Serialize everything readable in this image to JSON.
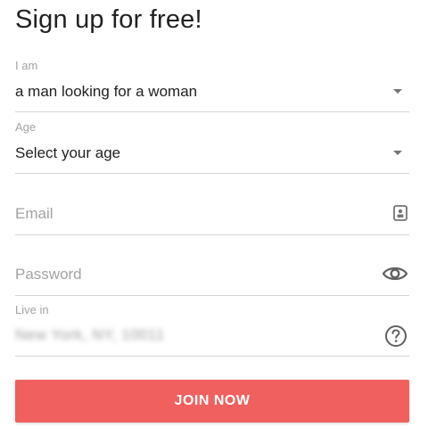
{
  "header": {
    "title": "Sign up for free!"
  },
  "form": {
    "gender": {
      "label": "I am",
      "value": "a man looking for a woman"
    },
    "age": {
      "label": "Age",
      "value": "Select your age"
    },
    "email": {
      "placeholder": "Email"
    },
    "password": {
      "placeholder": "Password"
    },
    "location": {
      "label": "Live in",
      "value": "New York, NY, 10011"
    },
    "submit_label": "JOIN NOW"
  },
  "colors": {
    "accent": "#f0605e",
    "divider": "#d4d4d4",
    "label": "#a3a3a3",
    "text": "#212121"
  },
  "icons": {
    "dropdown": "chevron-down-icon",
    "email": "contact-card-icon",
    "password": "eye-icon",
    "location": "help-circle-icon"
  }
}
